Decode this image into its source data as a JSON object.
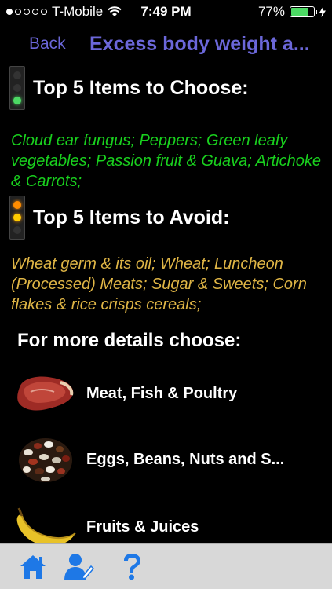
{
  "status_bar": {
    "carrier": "T-Mobile",
    "time": "7:49 PM",
    "battery_percent": "77%",
    "battery_level": 0.77,
    "signal_dots_filled": 1,
    "signal_dots_total": 5
  },
  "nav": {
    "back_label": "Back",
    "title": "Excess body weight a..."
  },
  "choose": {
    "title": "Top 5 Items to Choose:",
    "items": "Cloud ear fungus; Peppers; Green leafy vegetables; Passion fruit & Guava; Artichoke & Carrots;"
  },
  "avoid": {
    "title": "Top 5 Items to Avoid:",
    "items": "Wheat germ & its oil; Wheat; Luncheon (Processed) Meats; Sugar & Sweets; Corn flakes & rice crisps cereals;"
  },
  "details": {
    "header": "For more details choose:",
    "categories": [
      {
        "label": "Meat, Fish & Poultry",
        "icon": "meat-icon"
      },
      {
        "label": "Eggs, Beans, Nuts and S...",
        "icon": "beans-icon"
      },
      {
        "label": "Fruits & Juices",
        "icon": "banana-icon"
      }
    ]
  },
  "tabs": [
    {
      "icon": "home-icon"
    },
    {
      "icon": "user-edit-icon"
    },
    {
      "icon": "help-icon"
    }
  ],
  "colors": {
    "accent": "#6b67d9",
    "choose": "#19d11e",
    "avoid": "#e0b646",
    "tab_icon": "#1e78e6"
  }
}
